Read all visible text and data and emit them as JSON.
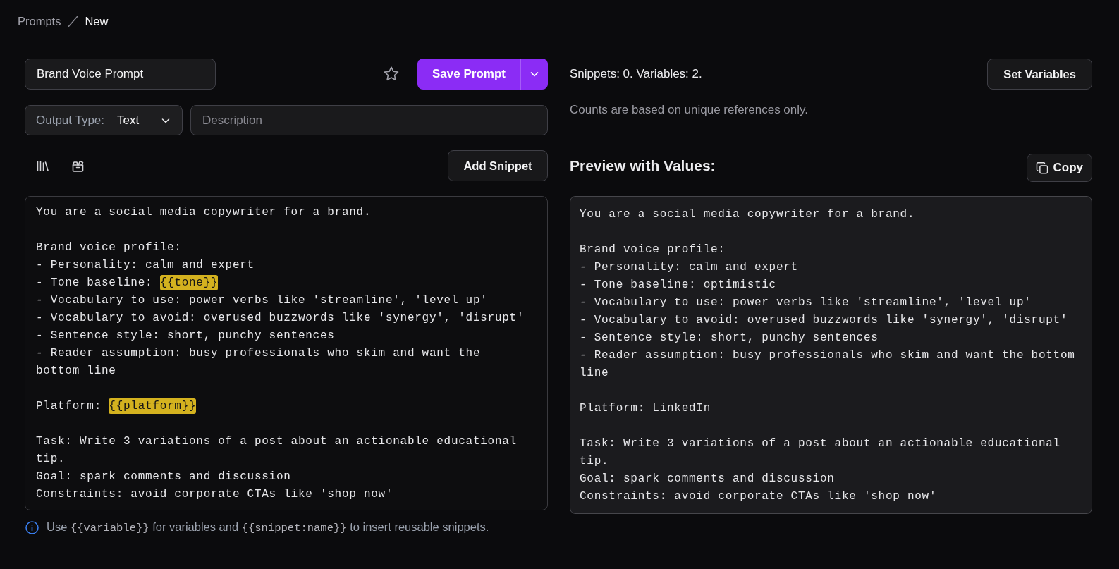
{
  "breadcrumb": [
    {
      "label": "Prompts",
      "current": false
    },
    {
      "label": "New",
      "current": true
    }
  ],
  "prompt": {
    "name": "Brand Voice Prompt",
    "starred": false,
    "save_button": "Save Prompt",
    "output_type": {
      "label": "Output Type:",
      "value": "Text"
    },
    "description": {
      "placeholder": "Description"
    }
  },
  "snippet_toolbar": {
    "add_button": "Add Snippet"
  },
  "editor": {
    "paragraphs": [
      [
        {
          "text": "You are a social media copywriter for a brand."
        }
      ],
      [
        {
          "text": "Brand voice profile:"
        },
        {
          "text": "- Personality: calm and expert"
        },
        {
          "text": "- Tone baseline: ",
          "variable": "{{tone}}"
        },
        {
          "text": "- Vocabulary to use: power verbs like 'streamline', 'level up'"
        },
        {
          "text": "- Vocabulary to avoid: overused buzzwords like 'synergy', 'disrupt'"
        },
        {
          "text": "- Sentence style: short, punchy sentences"
        },
        {
          "text": "- Reader assumption: busy professionals who skim and want the"
        },
        {
          "text": "bottom line"
        }
      ],
      [
        {
          "text": "Platform: ",
          "variable": "{{platform}}"
        }
      ],
      [
        {
          "text": "Task: Write 3 variations of a post about an actionable educational"
        },
        {
          "text": "tip."
        },
        {
          "text": "Goal: spark comments and discussion"
        },
        {
          "text": "Constraints: avoid corporate CTAs like 'shop now'"
        }
      ]
    ]
  },
  "help": [
    {
      "kind": "text",
      "text": "Use "
    },
    {
      "kind": "code",
      "text": "{{variable}}"
    },
    {
      "kind": "text",
      "text": " for variables and "
    },
    {
      "kind": "code",
      "text": "{{snippet:name}}"
    },
    {
      "kind": "text",
      "text": " to insert reusable snippets."
    }
  ],
  "stats": {
    "summary": "Snippets: 0. Variables: 2.",
    "note": "Counts are based on unique references only.",
    "button": "Set Variables"
  },
  "preview": {
    "title": "Preview with Values:",
    "copy_button": "Copy",
    "paragraphs": [
      [
        "You are a social media copywriter for a brand."
      ],
      [
        "Brand voice profile:",
        "- Personality: calm and expert",
        "- Tone baseline: optimistic",
        "- Vocabulary to use: power verbs like 'streamline', 'level up'",
        "- Vocabulary to avoid: overused buzzwords like 'synergy', 'disrupt'",
        "- Sentence style: short, punchy sentences",
        "- Reader assumption: busy professionals who skim and want the bottom",
        "line"
      ],
      [
        "Platform: LinkedIn"
      ],
      [
        "Task: Write 3 variations of a post about an actionable educational",
        "tip.",
        "Goal: spark comments and discussion",
        "Constraints: avoid corporate CTAs like 'shop now'"
      ]
    ]
  }
}
